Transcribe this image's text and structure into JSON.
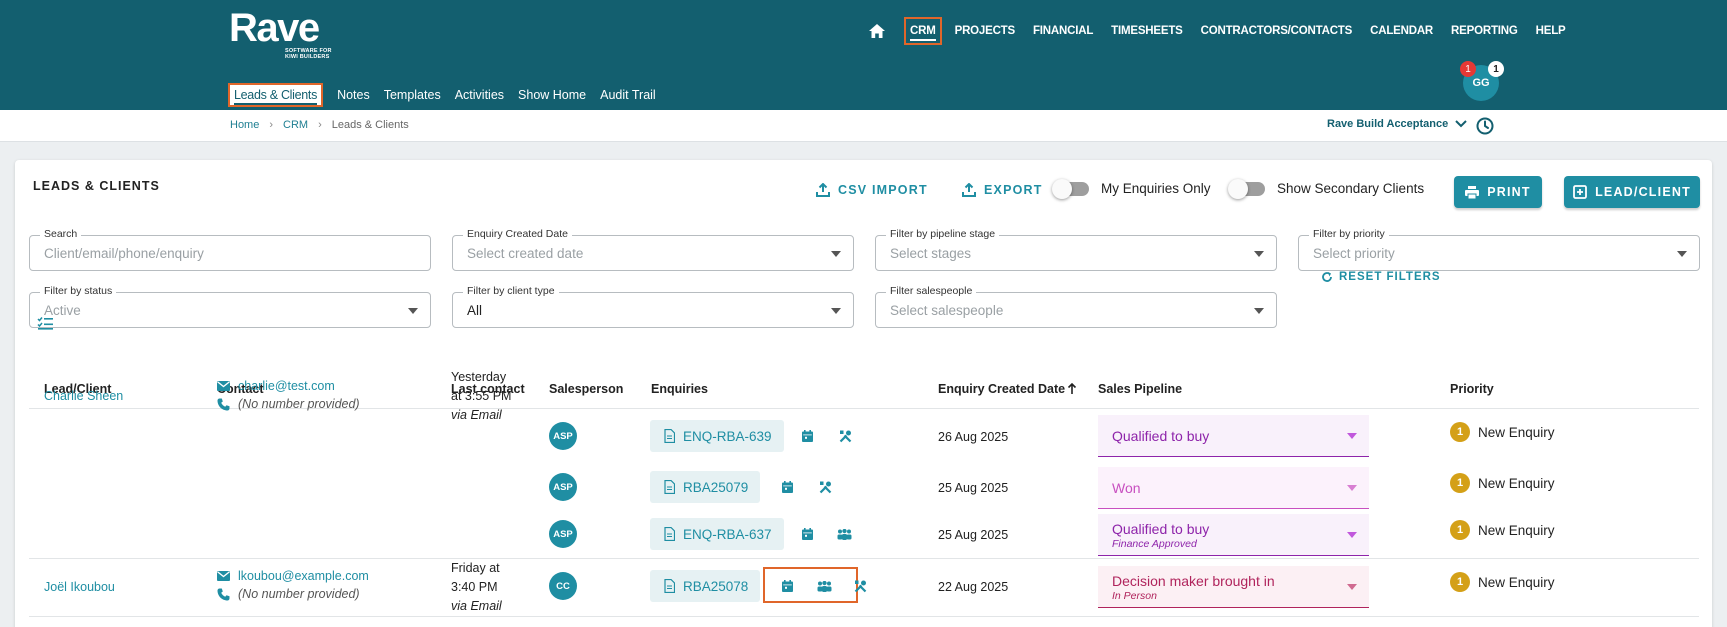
{
  "app": {
    "logo_word": "Rave",
    "logo_tagline": "SOFTWARE FOR KIWI BUILDERS"
  },
  "main_nav": [
    "CRM",
    "PROJECTS",
    "FINANCIAL",
    "TIMESHEETS",
    "CONTRACTORS/CONTACTS",
    "CALENDAR",
    "REPORTING",
    "HELP"
  ],
  "sub_nav": [
    "Leads & Clients",
    "Notes",
    "Templates",
    "Activities",
    "Show Home",
    "Audit Trail"
  ],
  "user": {
    "initials": "GG",
    "badge_left": "1",
    "badge_right": "1"
  },
  "breadcrumb": [
    "Home",
    "CRM",
    "Leads & Clients"
  ],
  "workspace": "Rave Build Acceptance",
  "page": {
    "title": "LEADS & CLIENTS",
    "csv_import": "CSV IMPORT",
    "export": "EXPORT",
    "my_enquiries": "My Enquiries Only",
    "secondary_clients": "Show Secondary Clients",
    "print": "PRINT",
    "lead_client": "LEAD/CLIENT"
  },
  "filters": {
    "search": {
      "label": "Search",
      "placeholder": "Client/email/phone/enquiry"
    },
    "created": {
      "label": "Enquiry Created Date",
      "placeholder": "Select created date"
    },
    "stage": {
      "label": "Filter by pipeline stage",
      "placeholder": "Select stages"
    },
    "priority": {
      "label": "Filter by priority",
      "placeholder": "Select priority"
    },
    "status": {
      "label": "Filter by status",
      "value": "Active"
    },
    "client_type": {
      "label": "Filter by client type",
      "value": "All"
    },
    "salespeople": {
      "label": "Filter salespeople",
      "placeholder": "Select salespeople"
    },
    "reset": "RESET FILTERS"
  },
  "table": {
    "headers": [
      "Lead/Client",
      "Contact",
      "Last contact",
      "Salesperson",
      "Enquiries",
      "Enquiry Created Date",
      "Sales Pipeline",
      "Priority"
    ],
    "clients": [
      {
        "name": "Charlie Sheen",
        "email": "charlie@test.com",
        "phone": "(No number provided)",
        "last_contact_1": "Yesterday",
        "last_contact_2": "at 3:55 PM",
        "last_contact_via": "via Email"
      },
      {
        "name": "Joël Ikoubou",
        "email": "lkoubou@example.com",
        "phone": "(No number provided)",
        "last_contact_1": "Friday at",
        "last_contact_2": "3:40 PM",
        "last_contact_via": "via Email"
      }
    ],
    "enquiries": [
      {
        "salesperson": "ASP",
        "code": "ENQ-RBA-639",
        "date": "26 Aug 2025",
        "stage": "Qualified to buy",
        "stage_sub": "",
        "stage_color": "#8e24aa",
        "priority_num": "1",
        "priority": "New Enquiry"
      },
      {
        "salesperson": "ASP",
        "code": "RBA25079",
        "date": "25 Aug 2025",
        "stage": "Won",
        "stage_sub": "",
        "stage_color": "#c850c0",
        "priority_num": "1",
        "priority": "New Enquiry"
      },
      {
        "salesperson": "ASP",
        "code": "ENQ-RBA-637",
        "date": "25 Aug 2025",
        "stage": "Qualified to buy",
        "stage_sub": "Finance Approved",
        "stage_color": "#8e24aa",
        "priority_num": "1",
        "priority": "New Enquiry"
      },
      {
        "salesperson": "CC",
        "code": "RBA25078",
        "date": "22 Aug 2025",
        "stage": "Decision maker brought in",
        "stage_sub": "In Person",
        "stage_color": "#b0245c",
        "priority_num": "1",
        "priority": "New Enquiry"
      }
    ]
  },
  "colors": {
    "header": "#135f6f",
    "accent": "#1f8ea3",
    "highlight": "#e0662a",
    "priority": "#d4a017"
  }
}
